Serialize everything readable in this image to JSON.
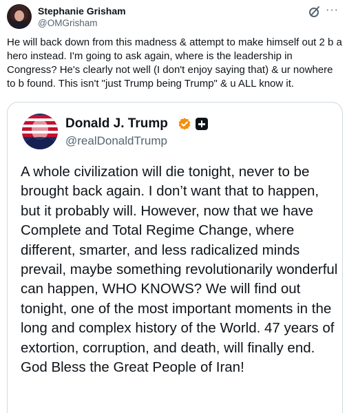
{
  "post": {
    "author_name": "Stephanie Grisham",
    "author_handle": "@OMGrisham",
    "text": "He will back down from this madness & attempt to make himself out 2 b a hero instead. I'm going to ask again, where is the leadership in Congress? He's clearly not well (I don't enjoy saying that) & ur nowhere to b found. This isn't \"just Trump being Trump\" & u ALL know it.",
    "more_label": "···"
  },
  "quoted": {
    "author_name": "Donald J. Trump",
    "author_handle": "@realDonaldTrump",
    "text": "A whole civilization will die tonight, never to be brought back again. I don’t want that to happen, but it probably will. However, now that we have Complete and Total Regime Change, where different, smarter, and less radicalized minds prevail, maybe something revolutionarily wonderful can happen, WHO KNOWS? We will find out tonight, one of the most important moments in the long and complex history of the World. 47 years of extortion, corruption, and death, will finally end. God Bless the Great People of Iran!"
  },
  "colors": {
    "text_primary": "#0f1419",
    "text_secondary": "#536471",
    "border": "#cfd9de",
    "verified": "#f4900c"
  },
  "icons": {
    "grok": "grok-icon",
    "more": "more-icon",
    "verified": "verified-badge-icon",
    "affiliate": "affiliate-badge-icon"
  }
}
